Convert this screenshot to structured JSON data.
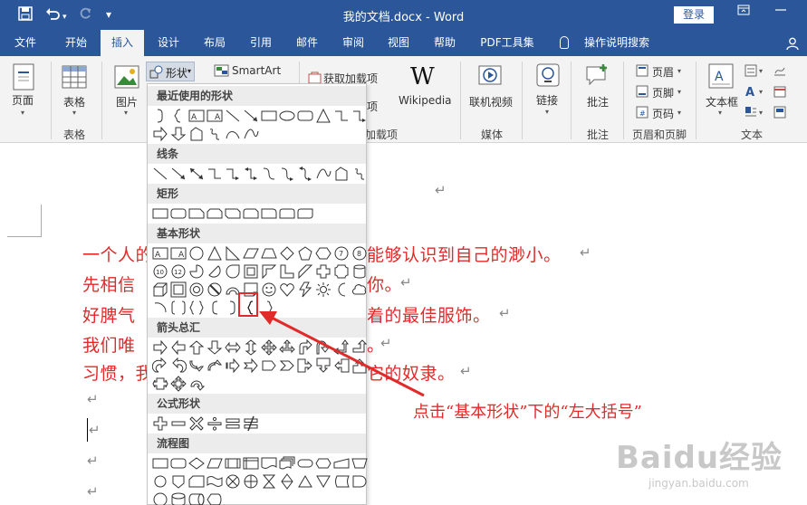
{
  "titlebar": {
    "title": "我的文档.docx - Word",
    "login": "登录",
    "save_icon": "save-icon",
    "undo_icon": "undo-icon",
    "redo_icon": "redo-icon"
  },
  "tabs": [
    "文件",
    "开始",
    "插入",
    "设计",
    "布局",
    "引用",
    "邮件",
    "审阅",
    "视图",
    "帮助",
    "PDF工具集",
    "操作说明搜索"
  ],
  "active_tab": "插入",
  "ribbon": {
    "pages": "页面",
    "table": "表格",
    "table_group": "表格",
    "pictures": "图片",
    "shapes": "形状",
    "smartart": "SmartArt",
    "get_addins": "获取加载项",
    "addins_group": "加载项",
    "wikipedia": "Wikipedia",
    "online_video": "联机视频",
    "media_group": "媒体",
    "link": "链接",
    "comment": "批注",
    "comment_group": "批注",
    "header": "页眉",
    "footer": "页脚",
    "page_number": "页码",
    "hf_group": "页眉和页脚",
    "textbox": "文本框",
    "text_group": "文本"
  },
  "shapes_menu": {
    "recent": "最近使用的形状",
    "lines": "线条",
    "rectangles": "矩形",
    "basic": "基本形状",
    "arrows": "箭头总汇",
    "equation": "公式形状",
    "flowchart": "流程图"
  },
  "document": {
    "lines": [
      "一个人的",
      "先相信",
      "好脾气",
      "我们唯",
      "习惯，我"
    ],
    "line_tails": [
      "能够认识到自己的渺小。",
      "你。",
      "着的最佳服饰。",
      "。",
      "它的奴隶。"
    ],
    "annotation": "点击“基本形状”下的“左大括号”",
    "watermark": "Baidu经验",
    "watermark_url": "jingyan.baidu.com"
  },
  "colors": {
    "accent": "#2b579a",
    "annotation": "#e12a2a"
  }
}
